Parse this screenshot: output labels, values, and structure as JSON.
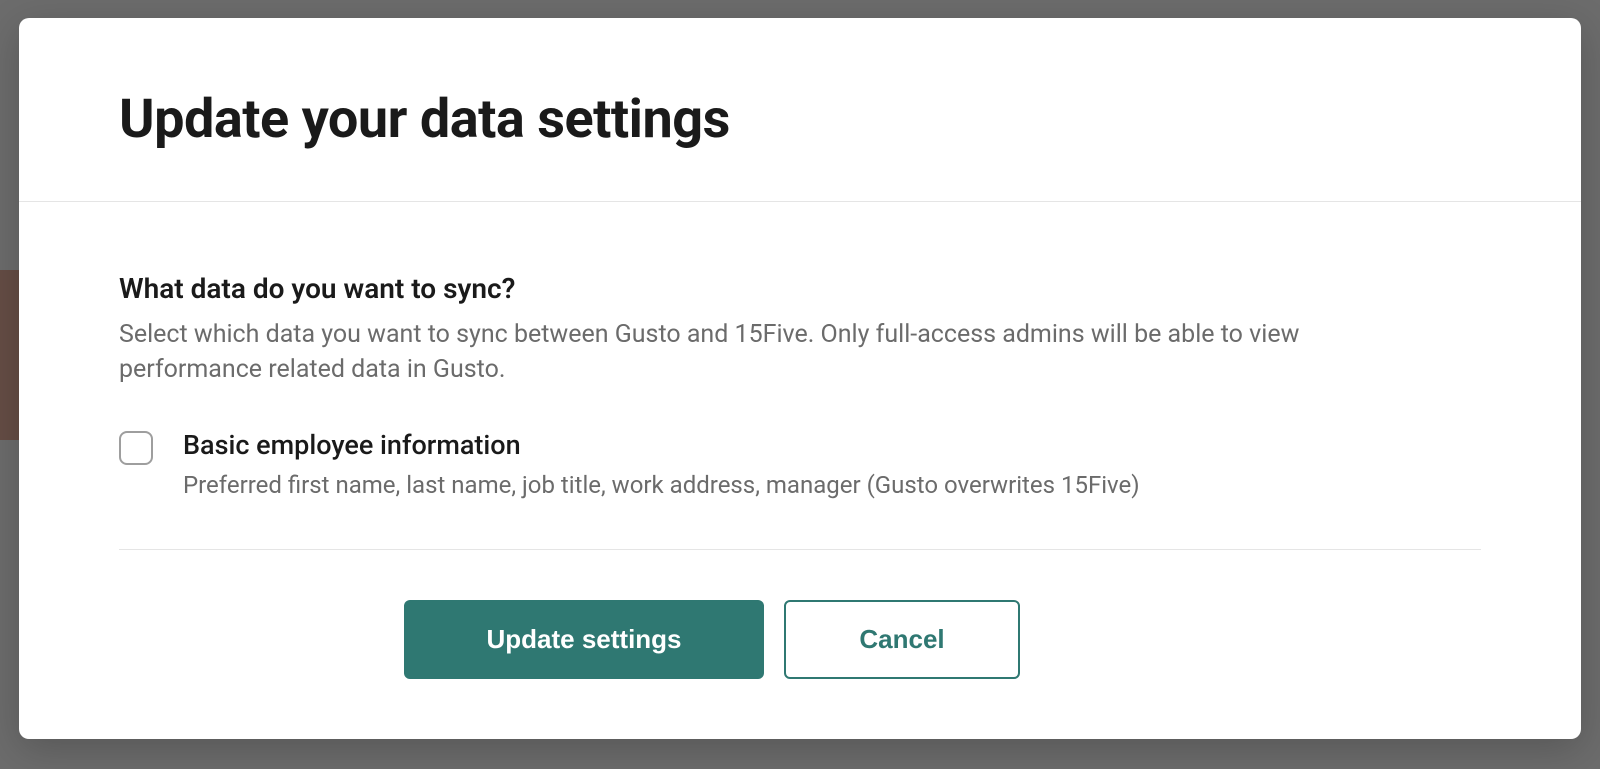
{
  "modal": {
    "title": "Update your data settings",
    "section": {
      "heading": "What data do you want to sync?",
      "description": "Select which data you want to sync between Gusto and 15Five. Only full-access admins will be able to view performance related data in Gusto."
    },
    "options": [
      {
        "label": "Basic employee information",
        "sub": "Preferred first name, last name, job title, work address, manager (Gusto overwrites 15Five)",
        "checked": false
      }
    ],
    "buttons": {
      "primary": "Update settings",
      "secondary": "Cancel"
    }
  }
}
